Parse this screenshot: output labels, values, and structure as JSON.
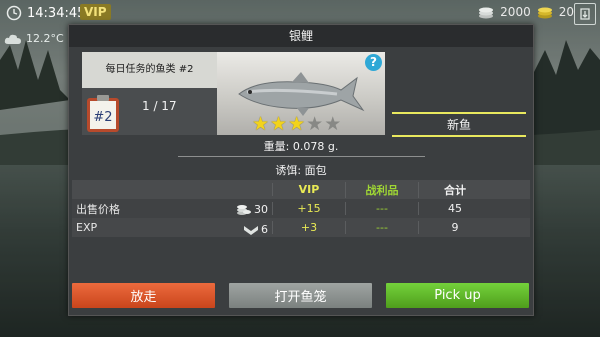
{
  "hud": {
    "time": "14:34:45",
    "vip": "VIP",
    "temperature": "12.2°C",
    "coins": "2000",
    "gold": "20",
    "exit_icon": "exit-door-icon",
    "clock_icon": "clock-icon",
    "weather_icon": "cloud-icon"
  },
  "dialog": {
    "title": "银鲤",
    "task": {
      "title": "每日任务的鱼类 #2",
      "badge": "#2",
      "count": "1 / 17"
    },
    "fish_image": "silver-carp-fish",
    "rating": {
      "filled": 3,
      "total": 5
    },
    "new_fish": "新鱼",
    "weight": "重量: 0.078 g.",
    "bait": "诱饵: 面包",
    "table": {
      "headers": {
        "vip": "VIP",
        "loot": "战利品",
        "total": "合计"
      },
      "rows": [
        {
          "label": "出售价格",
          "base": "30",
          "icon": "coin-stack-icon",
          "vip": "+15",
          "loot": "---",
          "total": "45"
        },
        {
          "label": "EXP",
          "base": "6",
          "icon": "chevron-exp-icon",
          "vip": "+3",
          "loot": "---",
          "total": "9"
        }
      ]
    },
    "buttons": {
      "release": "放走",
      "keepnet": "打开鱼笼",
      "pickup": "Pick up"
    }
  },
  "colors": {
    "release": "#d9552a",
    "keepnet": "#8d9290",
    "pickup": "#5fb62a",
    "vip_text": "#e9ea55",
    "loot_text": "#9fd634",
    "star": "#f2d31c"
  }
}
